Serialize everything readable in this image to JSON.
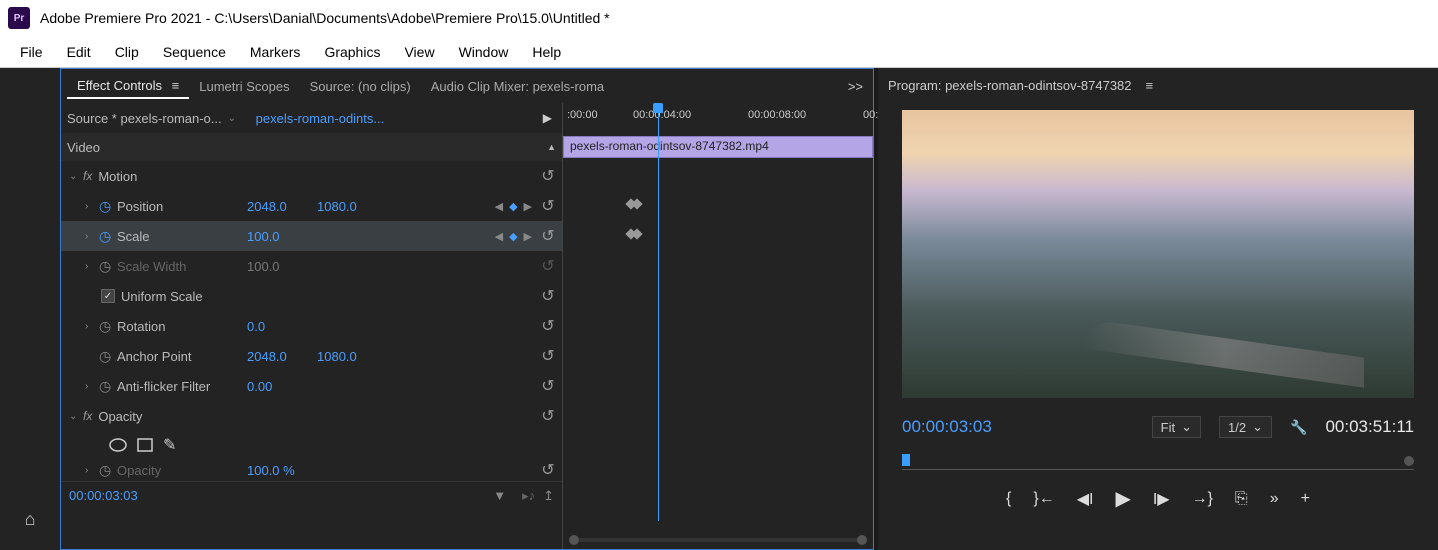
{
  "titlebar": {
    "app_icon_text": "Pr",
    "title": "Adobe Premiere Pro 2021 - C:\\Users\\Danial\\Documents\\Adobe\\Premiere Pro\\15.0\\Untitled *"
  },
  "menu": {
    "items": [
      "File",
      "Edit",
      "Clip",
      "Sequence",
      "Markers",
      "Graphics",
      "View",
      "Window",
      "Help"
    ]
  },
  "source_tabs": {
    "effect_controls": "Effect Controls",
    "lumetri": "Lumetri Scopes",
    "source": "Source: (no clips)",
    "audio_mixer": "Audio Clip Mixer: pexels-roma",
    "overflow": ">>"
  },
  "effect_controls": {
    "source_label": "Source * pexels-roman-o...",
    "sequence_link": "pexels-roman-odints...",
    "video_header": "Video",
    "motion": {
      "label": "Motion",
      "position": {
        "label": "Position",
        "x": "2048.0",
        "y": "1080.0"
      },
      "scale": {
        "label": "Scale",
        "value": "100.0"
      },
      "scale_width": {
        "label": "Scale Width",
        "value": "100.0"
      },
      "uniform": {
        "label": "Uniform Scale"
      },
      "rotation": {
        "label": "Rotation",
        "value": "0.0"
      },
      "anchor": {
        "label": "Anchor Point",
        "x": "2048.0",
        "y": "1080.0"
      },
      "antiflicker": {
        "label": "Anti-flicker Filter",
        "value": "0.00"
      }
    },
    "opacity": {
      "label": "Opacity",
      "value_label": "Opacity",
      "value": "100.0 %"
    },
    "timecode": "00:00:03:03"
  },
  "ec_timeline": {
    "ruler": [
      ":00:00",
      "00:00:04:00",
      "00:00:08:00",
      "00:"
    ],
    "clip_name": "pexels-roman-odintsov-8747382.mp4"
  },
  "program": {
    "tab_label": "Program: pexels-roman-odintsov-8747382",
    "timecode_in": "00:00:03:03",
    "fit_label": "Fit",
    "res_label": "1/2",
    "duration": "00:03:51:11"
  }
}
